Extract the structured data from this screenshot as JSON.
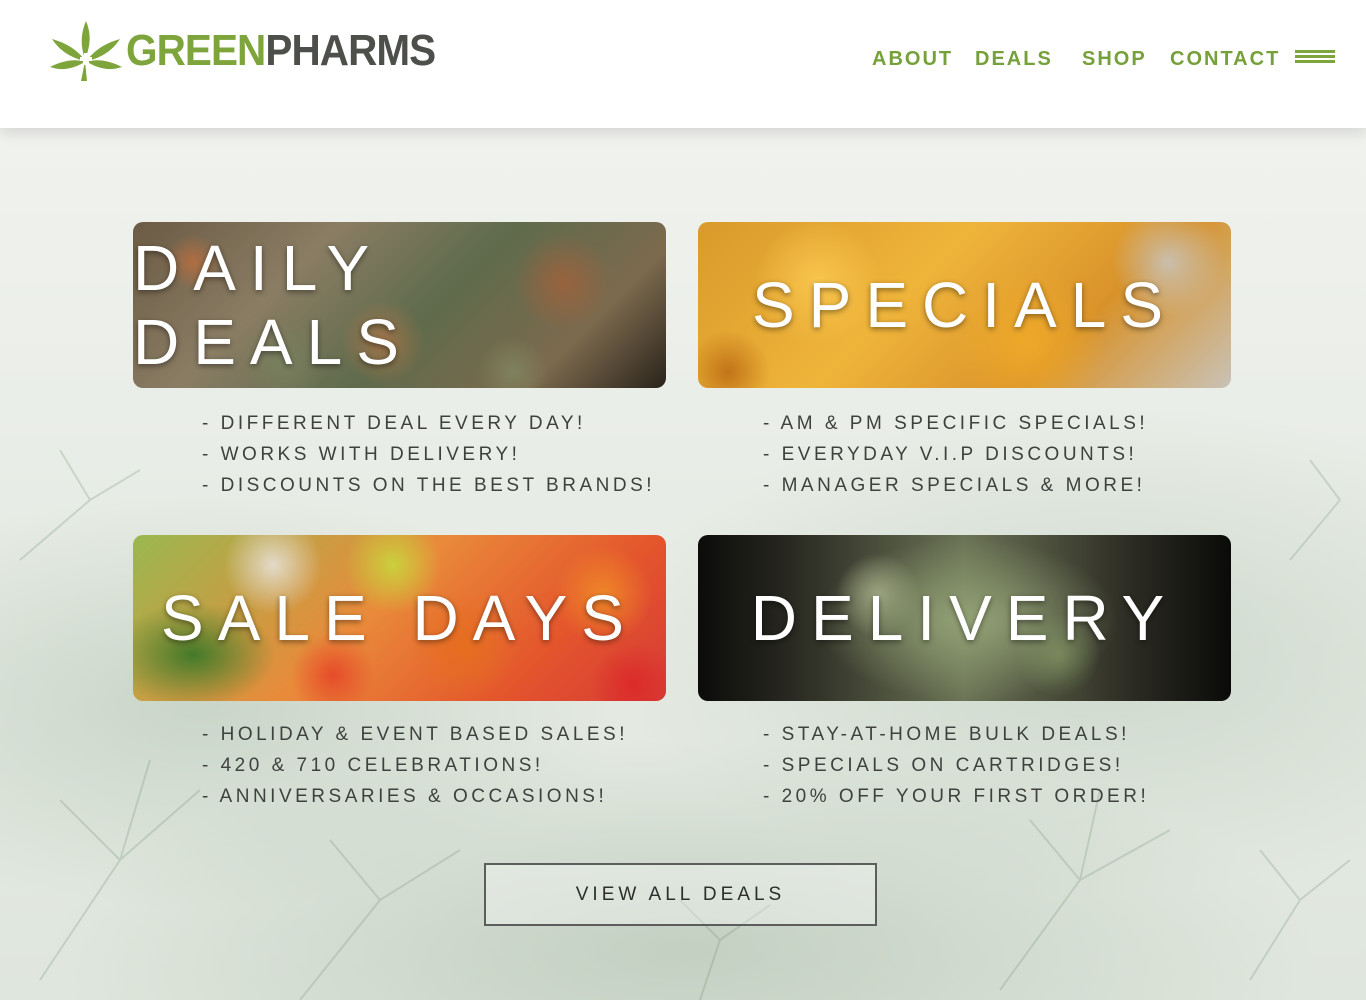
{
  "brand": {
    "name_part1": "GREEN",
    "name_part2": "PHARMS",
    "green": "#7ea53b",
    "gray": "#4d4f4a"
  },
  "nav": {
    "items": [
      {
        "label": "ABOUT"
      },
      {
        "label": "DEALS"
      },
      {
        "label": "SHOP"
      },
      {
        "label": "CONTACT"
      }
    ],
    "menu_icon": "hamburger-menu-icon"
  },
  "cards": [
    {
      "title": "DAILY DEALS",
      "bullets": [
        "- DIFFERENT DEAL EVERY DAY!",
        "- WORKS WITH DELIVERY!",
        "- DISCOUNTS ON THE BEST BRANDS!"
      ]
    },
    {
      "title": "SPECIALS",
      "bullets": [
        "- AM & PM SPECIFIC SPECIALS!",
        "- EVERYDAY V.I.P DISCOUNTS!",
        "- MANAGER SPECIALS & MORE!"
      ]
    },
    {
      "title": "SALE DAYS",
      "bullets": [
        "- HOLIDAY & EVENT BASED SALES!",
        "- 420 & 710 CELEBRATIONS!",
        "- ANNIVERSARIES & OCCASIONS!"
      ]
    },
    {
      "title": "DELIVERY",
      "bullets": [
        "- STAY-AT-HOME BULK DEALS!",
        "- SPECIALS ON CARTRIDGES!",
        "- 20% OFF YOUR FIRST ORDER!"
      ]
    }
  ],
  "cta": {
    "label": "VIEW ALL DEALS"
  }
}
